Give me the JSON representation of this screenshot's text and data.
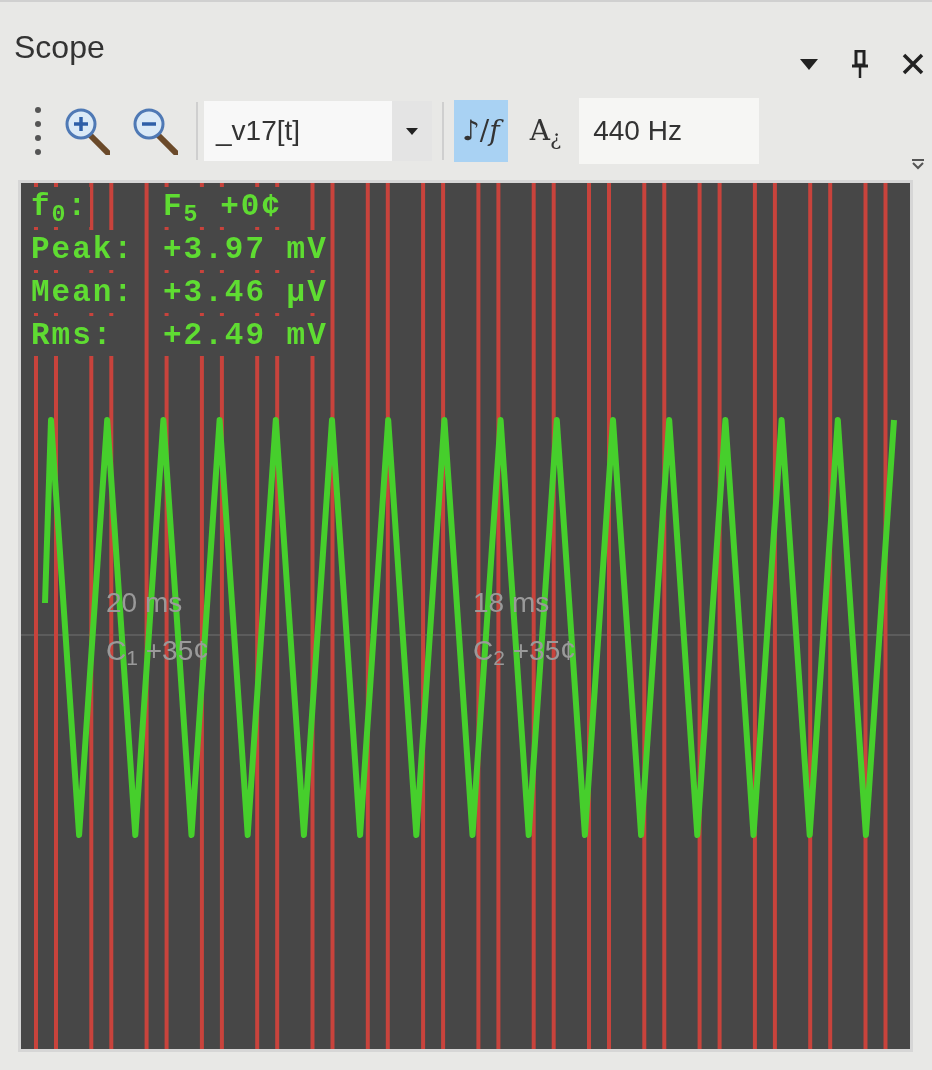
{
  "window": {
    "title": "Scope"
  },
  "toolbar": {
    "tools": [
      {
        "kind": "zoom_in"
      },
      {
        "kind": "zoom_out"
      }
    ],
    "channel": {
      "value": "_v17[t]"
    },
    "toggles": [
      {
        "label": "♪/*f*",
        "selected": true
      },
      {
        "label": "A$_{¿}$",
        "selected": false
      }
    ],
    "frequency": {
      "value": "440 Hz"
    }
  },
  "display": {
    "readouts": [
      {
        "label": "f$_{0}$:",
        "value": "F$_{5}$ +0¢"
      },
      {
        "label": "Peak:",
        "value": "+3.97 mV"
      },
      {
        "label": "Mean:",
        "value": "+3.46 µV"
      },
      {
        "label": "Rms:",
        "value": "+2.49 mV"
      }
    ],
    "cursors": [
      {
        "time": "20 ms",
        "note": "C$_{1}$ +35¢"
      },
      {
        "time": "18 ms",
        "note": "C$_{2}$ +35¢"
      }
    ]
  }
}
